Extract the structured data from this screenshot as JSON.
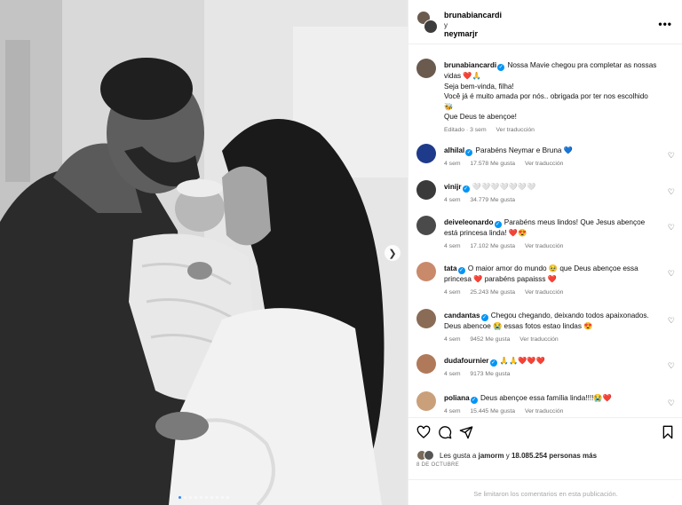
{
  "header": {
    "user1": "brunabiancardi",
    "conjunction": "y",
    "user2": "neymarjr",
    "more_icon": "more-horizontal-icon"
  },
  "caption": {
    "user": "brunabiancardi",
    "line1": "Nossa Mavie chegou pra completar as nossas vidas ❤️🙏",
    "line2": "Seja bem-vinda, filha!",
    "line3": "Você já é muito amada por nós.. obrigada por ter nos escolhido 🐝",
    "line4": "Que Deus te abençoe!",
    "edited": "Editado · 3 sem",
    "translate": "Ver traducción"
  },
  "comments": [
    {
      "user": "alhilal",
      "text": "Parabéns Neymar e Bruna 💙",
      "time": "4 sem",
      "likes": "17.578 Me gusta",
      "translate": "Ver traducción",
      "avatar_color": "#1e3a8a"
    },
    {
      "user": "vinijr",
      "text": "🤍🤍🤍🤍🤍🤍🤍",
      "time": "4 sem",
      "likes": "34.779 Me gusta",
      "translate": "",
      "avatar_color": "#3a3a3a"
    },
    {
      "user": "deiveleonardo",
      "text": "Parabéns meus lindos! Que Jesus abençoe está princesa linda! ❤️😍",
      "time": "4 sem",
      "likes": "17.102 Me gusta",
      "translate": "Ver traducción",
      "avatar_color": "#4a4a4a"
    },
    {
      "user": "tata",
      "text": "O maior amor do mundo 🥹 que Deus abençoe essa princesa ❤️ parabéns papaisss ❤️",
      "time": "4 sem",
      "likes": "25.243 Me gusta",
      "translate": "Ver traducción",
      "avatar_color": "#c98a6b"
    },
    {
      "user": "candantas",
      "text": "Chegou chegando, deixando todos apaixonados. Deus abencoe 😭 essas fotos estao lindas 😍",
      "time": "4 sem",
      "likes": "9452 Me gusta",
      "translate": "Ver traducción",
      "avatar_color": "#8a6b55"
    },
    {
      "user": "dudafournier",
      "text": "🙏🙏❤️❤️❤️",
      "time": "4 sem",
      "likes": "9173 Me gusta",
      "translate": "",
      "avatar_color": "#b07a5a"
    },
    {
      "user": "poliana",
      "text": "Deus abençoe essa família linda!!!!😭❤️",
      "time": "4 sem",
      "likes": "15.445 Me gusta",
      "translate": "Ver traducción",
      "avatar_color": "#caa07a"
    }
  ],
  "actions": {
    "like_icon": "heart-icon",
    "comment_icon": "comment-icon",
    "share_icon": "send-icon",
    "save_icon": "bookmark-icon"
  },
  "likes": {
    "prefix": "Les gusta a",
    "user": "jamorm",
    "middle": "y",
    "count": "18.085.254 personas más"
  },
  "date": "8 DE OCTUBRE",
  "comments_limited": "Se limitaron los comentarios en esta publicación.",
  "carousel": {
    "total": 10,
    "active": 0
  }
}
